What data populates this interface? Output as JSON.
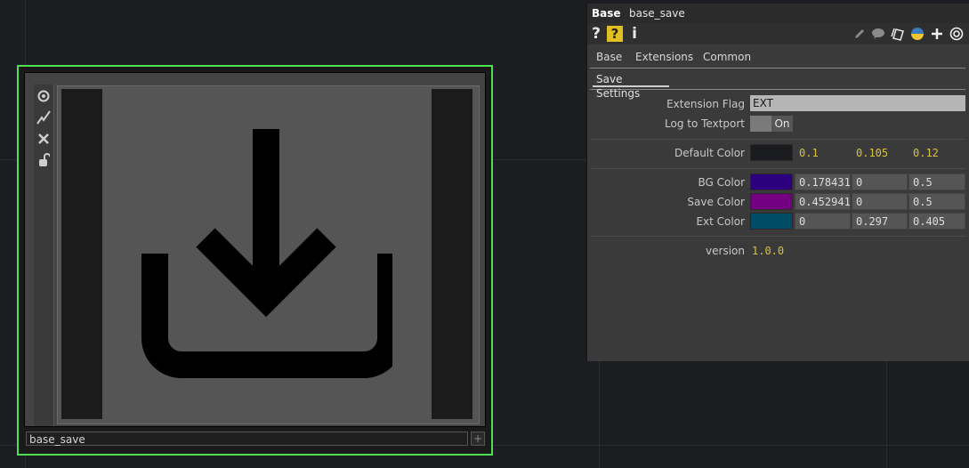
{
  "node": {
    "name": "base_save",
    "plus_glyph": "+",
    "border_color": "#4fe04f",
    "viewer_icon": "download-save-icon",
    "toolbar_icons": [
      "eye-icon",
      "pulse-icon",
      "close-icon",
      "unlock-icon"
    ]
  },
  "panel": {
    "op_type": "Base",
    "op_name": "base_save",
    "toolbar": {
      "help": "?",
      "help_python": "?",
      "info": "i",
      "icons_right": [
        "pencil-icon",
        "comment-icon",
        "clone-icon",
        "python-icon",
        "plus-icon",
        "target-icon"
      ]
    },
    "tabs": [
      "Base",
      "Extensions",
      "Common"
    ],
    "subtab": "Save Settings",
    "params": {
      "extension_flag": {
        "label": "Extension Flag",
        "value": "EXT"
      },
      "log_to_textport": {
        "label": "Log to Textport",
        "value": "On"
      },
      "default_color": {
        "label": "Default Color",
        "r": "0.1",
        "g": "0.105",
        "b": "0.12",
        "swatch": "#1a1b1f"
      },
      "bg_color": {
        "label": "BG Color",
        "r": "0.178431",
        "g": "0",
        "b": "0.5",
        "swatch": "#2d0080"
      },
      "save_color": {
        "label": "Save Color",
        "r": "0.452941",
        "g": "0",
        "b": "0.5",
        "swatch": "#730080"
      },
      "ext_color": {
        "label": "Ext Color",
        "r": "0",
        "g": "0.297",
        "b": "0.405",
        "swatch": "#004c67"
      },
      "version": {
        "label": "version",
        "value": "1.0.0"
      }
    }
  }
}
